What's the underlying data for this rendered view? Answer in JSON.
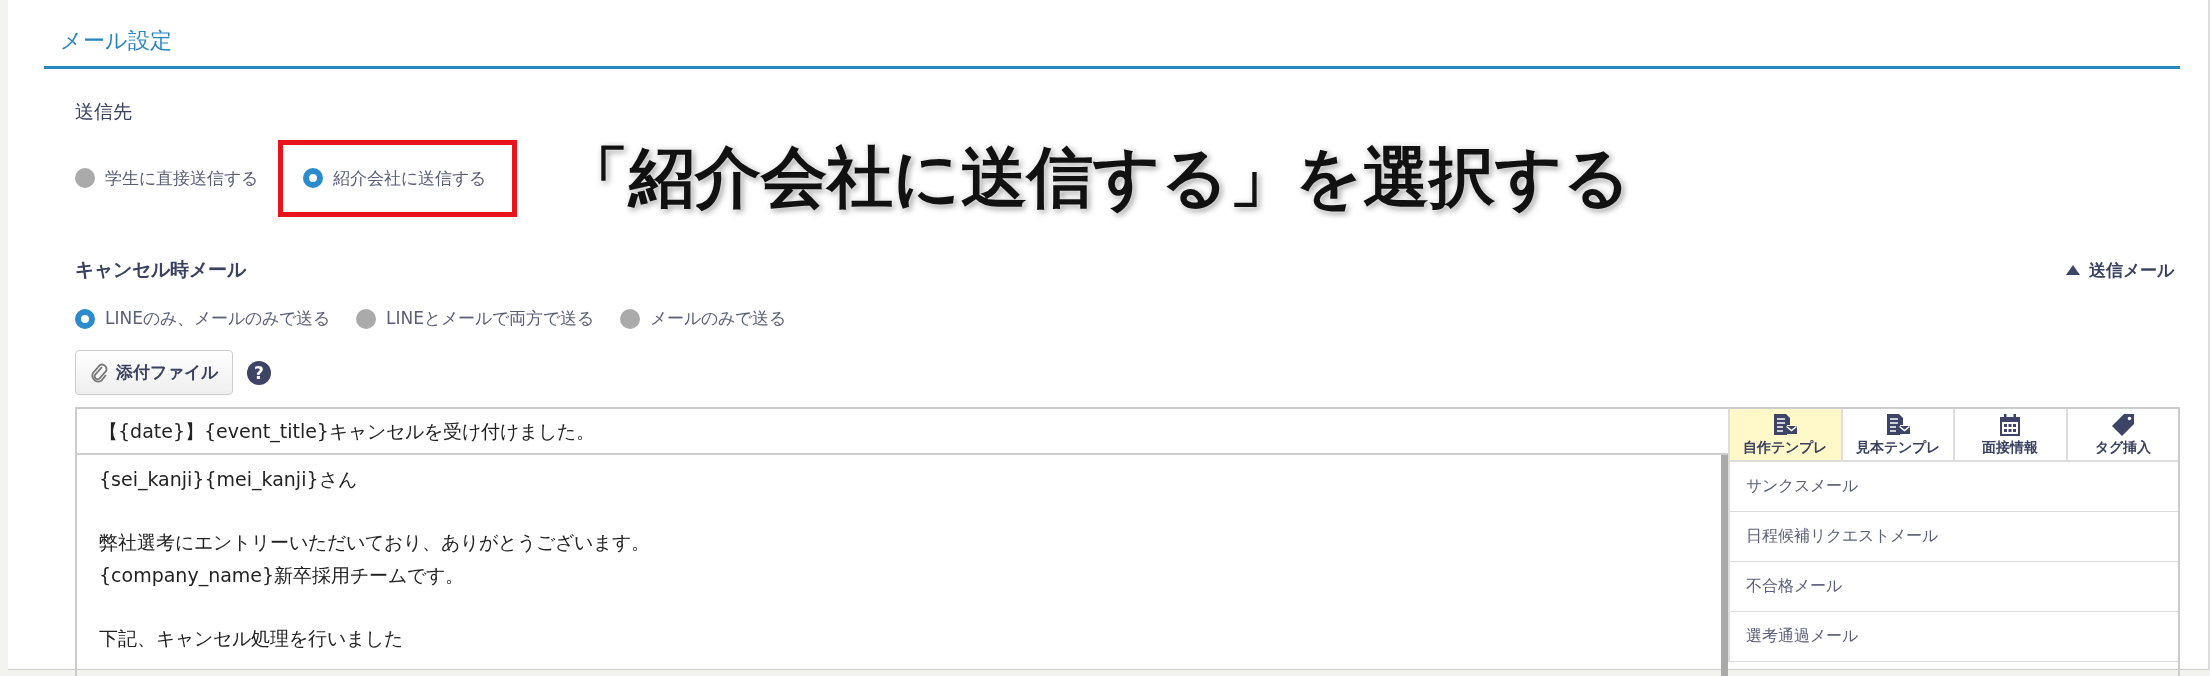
{
  "section_title": "メール設定",
  "recipient": {
    "label": "送信先",
    "options": [
      {
        "label": "学生に直接送信する",
        "selected": false,
        "highlighted": false
      },
      {
        "label": "紹介会社に送信する",
        "selected": true,
        "highlighted": true
      }
    ]
  },
  "annotation": {
    "text": "「紹介会社に送信する」を選択する"
  },
  "cancel_mail": {
    "label": "キャンセル時メール",
    "toggle": "送信メール",
    "options": [
      {
        "label": "LINEのみ、メールのみで送る",
        "selected": true
      },
      {
        "label": "LINEとメールで両方で送る",
        "selected": false
      },
      {
        "label": "メールのみで送る",
        "selected": false
      }
    ],
    "attach_button": "添付ファイル",
    "help_icon": "?"
  },
  "editor": {
    "subject": "【{date}】{event_title}キャンセルを受け付けました。",
    "body": [
      [
        "{sei_kanji}{mei_kanji}さん"
      ],
      [
        "弊社選考にエントリーいただいており、ありがとうございます。",
        "{company_name}新卒採用チームです。"
      ],
      [
        "下記、キャンセル処理を行いました"
      ]
    ],
    "tabs": [
      {
        "label": "自作テンプレ",
        "selected": true
      },
      {
        "label": "見本テンプレ",
        "selected": false
      },
      {
        "label": "面接情報",
        "selected": false
      },
      {
        "label": "タグ挿入",
        "selected": false
      }
    ],
    "templates": [
      "サンクスメール",
      "日程候補リクエストメール",
      "不合格メール",
      "選考通過メール"
    ]
  }
}
